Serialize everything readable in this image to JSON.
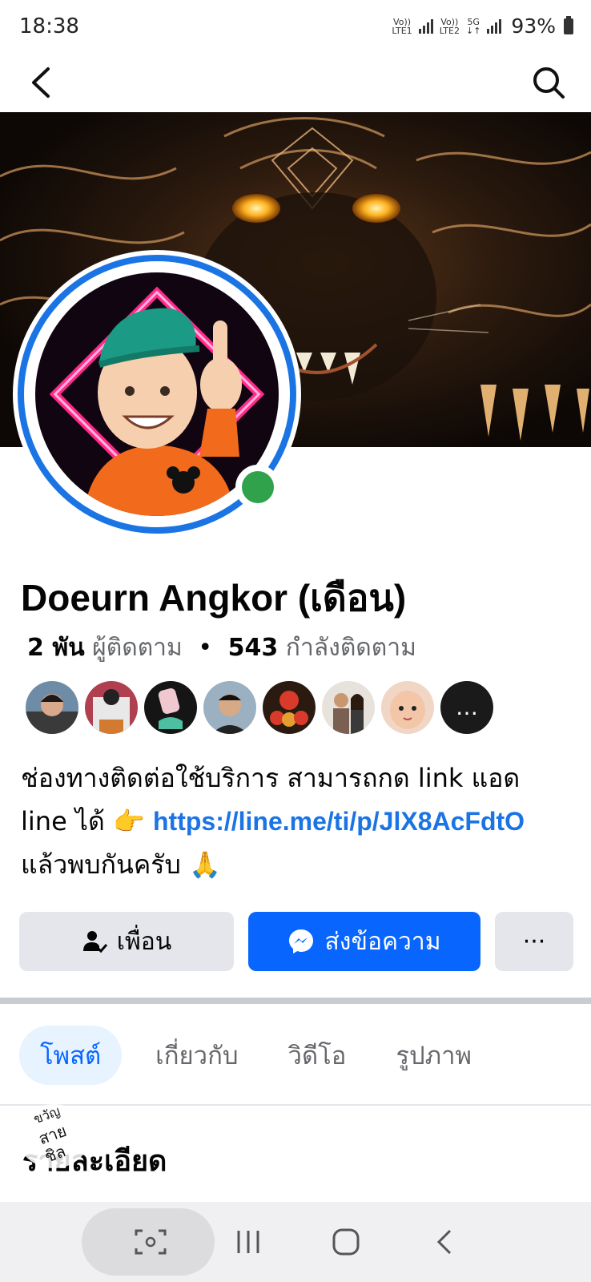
{
  "status_bar": {
    "time": "18:38",
    "sim1_label_top": "Vo))",
    "sim1_label_bottom": "LTE1",
    "sim2_label_top": "Vo))",
    "sim2_label_bottom": "LTE2",
    "network_label": "5G",
    "battery_percent": "93%"
  },
  "nav": {
    "back_icon": "chevron-left-icon",
    "search_icon": "search-icon"
  },
  "profile": {
    "name": "Doeurn Angkor (เดือน)",
    "followers_count": "2 พัน",
    "followers_label": "ผู้ติดตาม",
    "separator": "•",
    "following_count": "543",
    "following_label": "กำลังติดตาม",
    "online": true
  },
  "friends": {
    "more_label": "…"
  },
  "bio": {
    "text_1": "ช่องทางติดต่อใช้บริการ สามารถกด link แอด line ได้ ",
    "emoji_pointing": "👉",
    "link": "https://line.me/ti/p/JlX8AcFdtO",
    "text_2": " แล้วพบกันครับ ",
    "emoji_pray": "🙏"
  },
  "actions": {
    "friend_label": "เพื่อน",
    "message_label": "ส่งข้อความ",
    "more_label": "···"
  },
  "tabs": [
    {
      "label": "โพสต์",
      "active": true
    },
    {
      "label": "เกี่ยวกับ",
      "active": false
    },
    {
      "label": "วิดีโอ",
      "active": false
    },
    {
      "label": "รูปภาพ",
      "active": false
    }
  ],
  "section": {
    "title": "รายละเอียด"
  },
  "watermark": {
    "line1": "ขวัญ",
    "line2": "สาย",
    "line3": "ชิล"
  },
  "colors": {
    "accent": "#0866ff",
    "link": "#1b74e4",
    "online": "#31a24c"
  }
}
